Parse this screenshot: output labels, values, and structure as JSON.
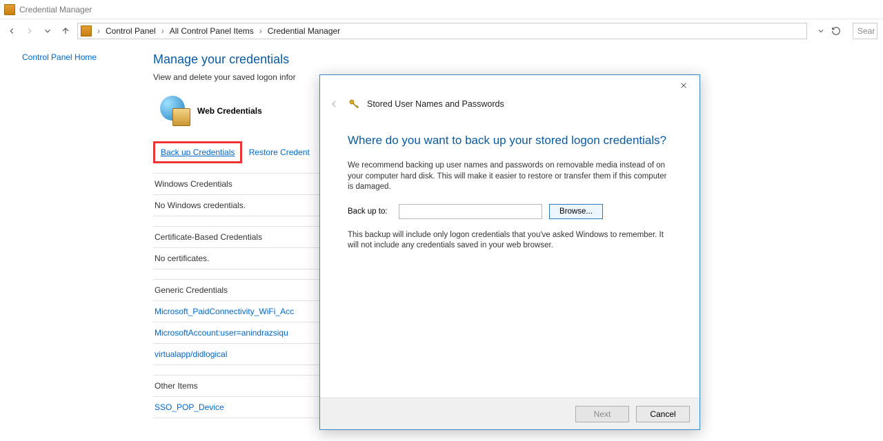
{
  "titlebar": {
    "title": "Credential Manager"
  },
  "nav": {
    "back_enabled": true,
    "forward_enabled": false
  },
  "breadcrumb": {
    "items": [
      "Control Panel",
      "All Control Panel Items",
      "Credential Manager"
    ]
  },
  "search": {
    "placeholder": "Sear"
  },
  "sidebar": {
    "home_link": "Control Panel Home"
  },
  "main": {
    "heading": "Manage your credentials",
    "subheading": "View and delete your saved logon infor",
    "web_credentials_label": "Web Credentials",
    "backup_label": "Back up Credentials",
    "restore_label": "Restore Credent",
    "sections": {
      "windows": {
        "title": "Windows Credentials",
        "empty": "No Windows credentials."
      },
      "cert": {
        "title": "Certificate-Based Credentials",
        "empty": "No certificates."
      },
      "generic": {
        "title": "Generic Credentials",
        "items": [
          "Microsoft_PaidConnectivity_WiFi_Acc",
          "MicrosoftAccount:user=anindrazsiqu",
          "virtualapp/didlogical"
        ]
      },
      "other": {
        "title": "Other Items",
        "items": [
          "SSO_POP_Device"
        ]
      }
    }
  },
  "dialog": {
    "title": "Stored User Names and Passwords",
    "heading": "Where do you want to back up your stored logon credentials?",
    "p1": "We recommend backing up user names and passwords on removable media instead of on your computer hard disk. This will make it easier to restore or transfer them if this computer is damaged.",
    "field_label": "Back up to:",
    "field_value": "",
    "browse_label": "Browse...",
    "p2": "This backup will include only logon credentials that you've asked Windows to remember. It will not include any credentials saved in your web browser.",
    "next_label": "Next",
    "cancel_label": "Cancel",
    "next_enabled": false
  }
}
